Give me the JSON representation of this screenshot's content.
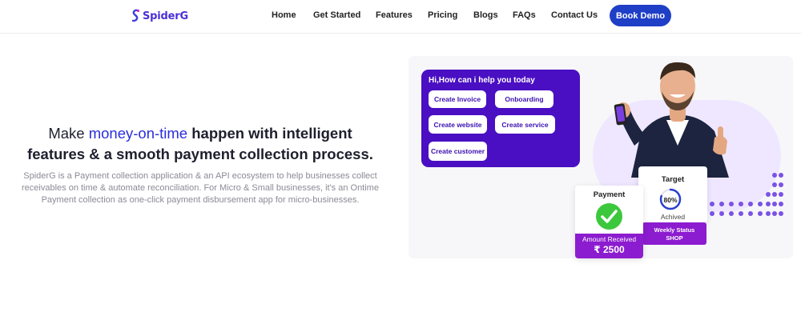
{
  "nav": {
    "brand": "SpiderG",
    "links": [
      "Home",
      "Get Started",
      "Features",
      "Pricing",
      "Blogs",
      "FAQs",
      "Contact Us"
    ],
    "cta": "Book Demo"
  },
  "hero": {
    "headline_pre": "Make ",
    "headline_accent": "money-on-time",
    "headline_bold": " happen with intelligent features & a smooth payment collection process.",
    "description": "SpiderG is a Payment collection application & an API ecosystem to help businesses collect receivables on time & automate reconciliation. For Micro & Small businesses, it's an Ontime Payment collection as one-click payment disbursement app for micro-businesses."
  },
  "chat": {
    "title": "Hi,How can i help you today",
    "options": [
      "Create Invoice",
      "Onboarding",
      "Create website",
      "Create service",
      "Create customer"
    ]
  },
  "payment_card": {
    "title": "Payment",
    "amount_label": "Amount Received",
    "amount": "₹ 2500"
  },
  "target_card": {
    "title": "Target",
    "progress": "80%",
    "progress_value": 0.8,
    "status": "Achived",
    "badge_line1": "Weekly Status",
    "badge_line2": "SHOP"
  },
  "colors": {
    "brand": "#4a2fd6",
    "cta": "#1f3fc7",
    "chat_bg": "#4a0fc2",
    "accent_purple": "#8c1ccf",
    "success_green": "#3cc83c"
  }
}
